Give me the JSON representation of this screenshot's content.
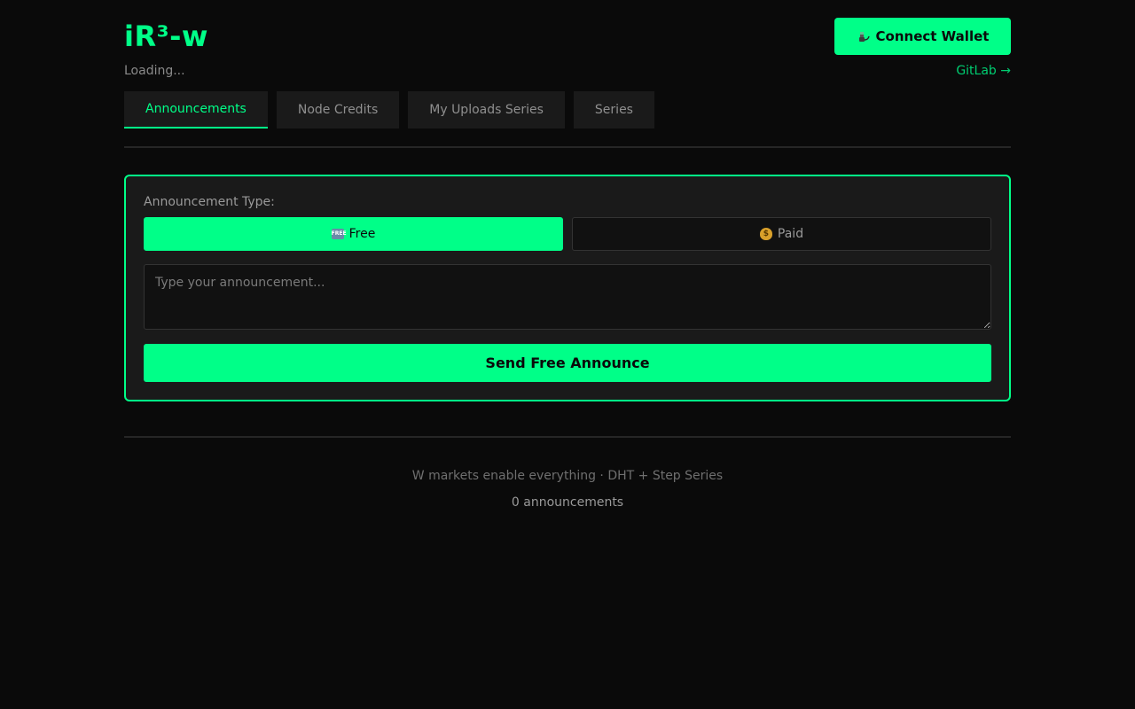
{
  "header": {
    "logo": "iR³-w",
    "status": "Loading...",
    "connect_label": "Connect Wallet",
    "connect_icon": "plug-icon",
    "gitlab_label": "GitLab →"
  },
  "tabs": [
    {
      "label": "Announcements",
      "active": true
    },
    {
      "label": "Node Credits",
      "active": false
    },
    {
      "label": "My Uploads Series",
      "active": false
    },
    {
      "label": "Series",
      "active": false
    }
  ],
  "announce": {
    "type_label": "Announcement Type:",
    "free_label": "Free",
    "free_icon": "free-icon",
    "paid_label": "Paid",
    "paid_icon": "money-bag-icon",
    "selected_type": "Free",
    "input_placeholder": "Type your announcement...",
    "input_value": "",
    "send_label": "Send Free Announce"
  },
  "footer": {
    "tagline": "W markets enable everything · DHT + Step Series",
    "count": "0 announcements"
  },
  "colors": {
    "accent": "#00ff88",
    "background": "#0a0a0a",
    "card": "#1a1a1a"
  }
}
